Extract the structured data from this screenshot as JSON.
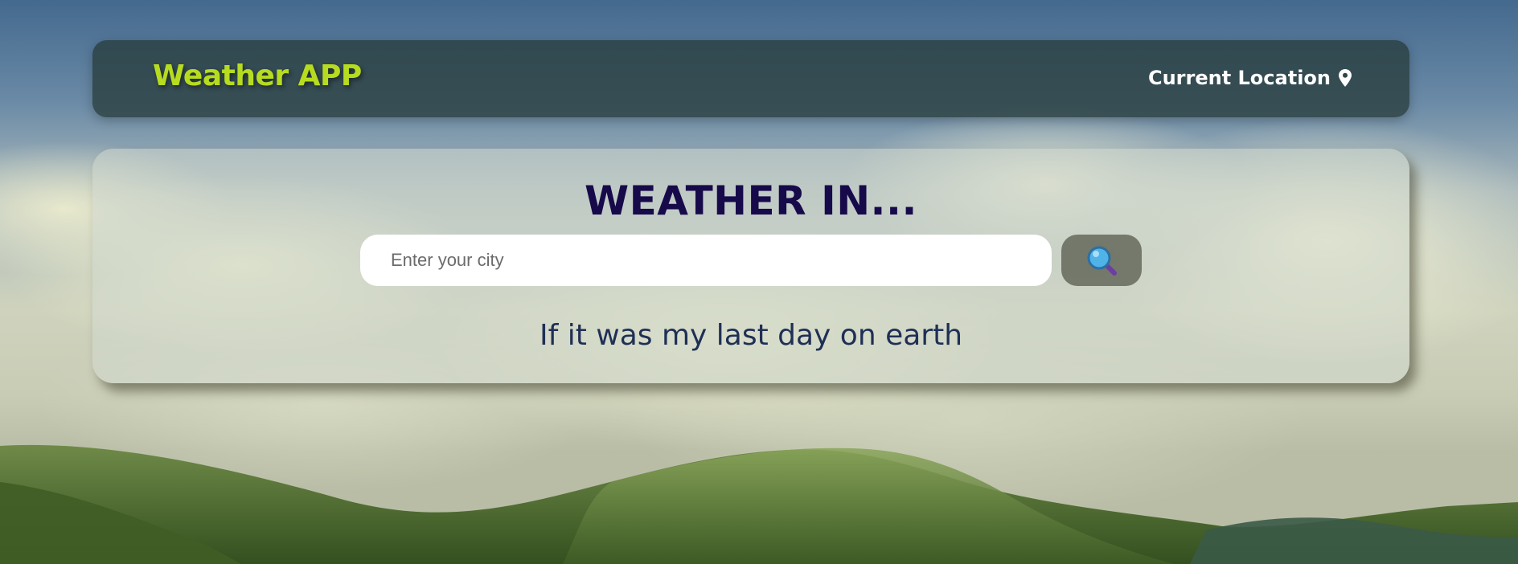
{
  "navbar": {
    "brand": "Weather APP",
    "location_label": "Current Location",
    "location_icon": "map-pin-icon"
  },
  "main": {
    "title": "WEATHER IN...",
    "search": {
      "placeholder": "Enter your city",
      "value": "",
      "button_icon": "search-icon"
    },
    "quote": "If it was my last day on earth"
  },
  "colors": {
    "brand": "#b7dc1f",
    "title": "#170a4a",
    "quote": "#1f2f55",
    "navbar_bg": "#283c3c"
  }
}
